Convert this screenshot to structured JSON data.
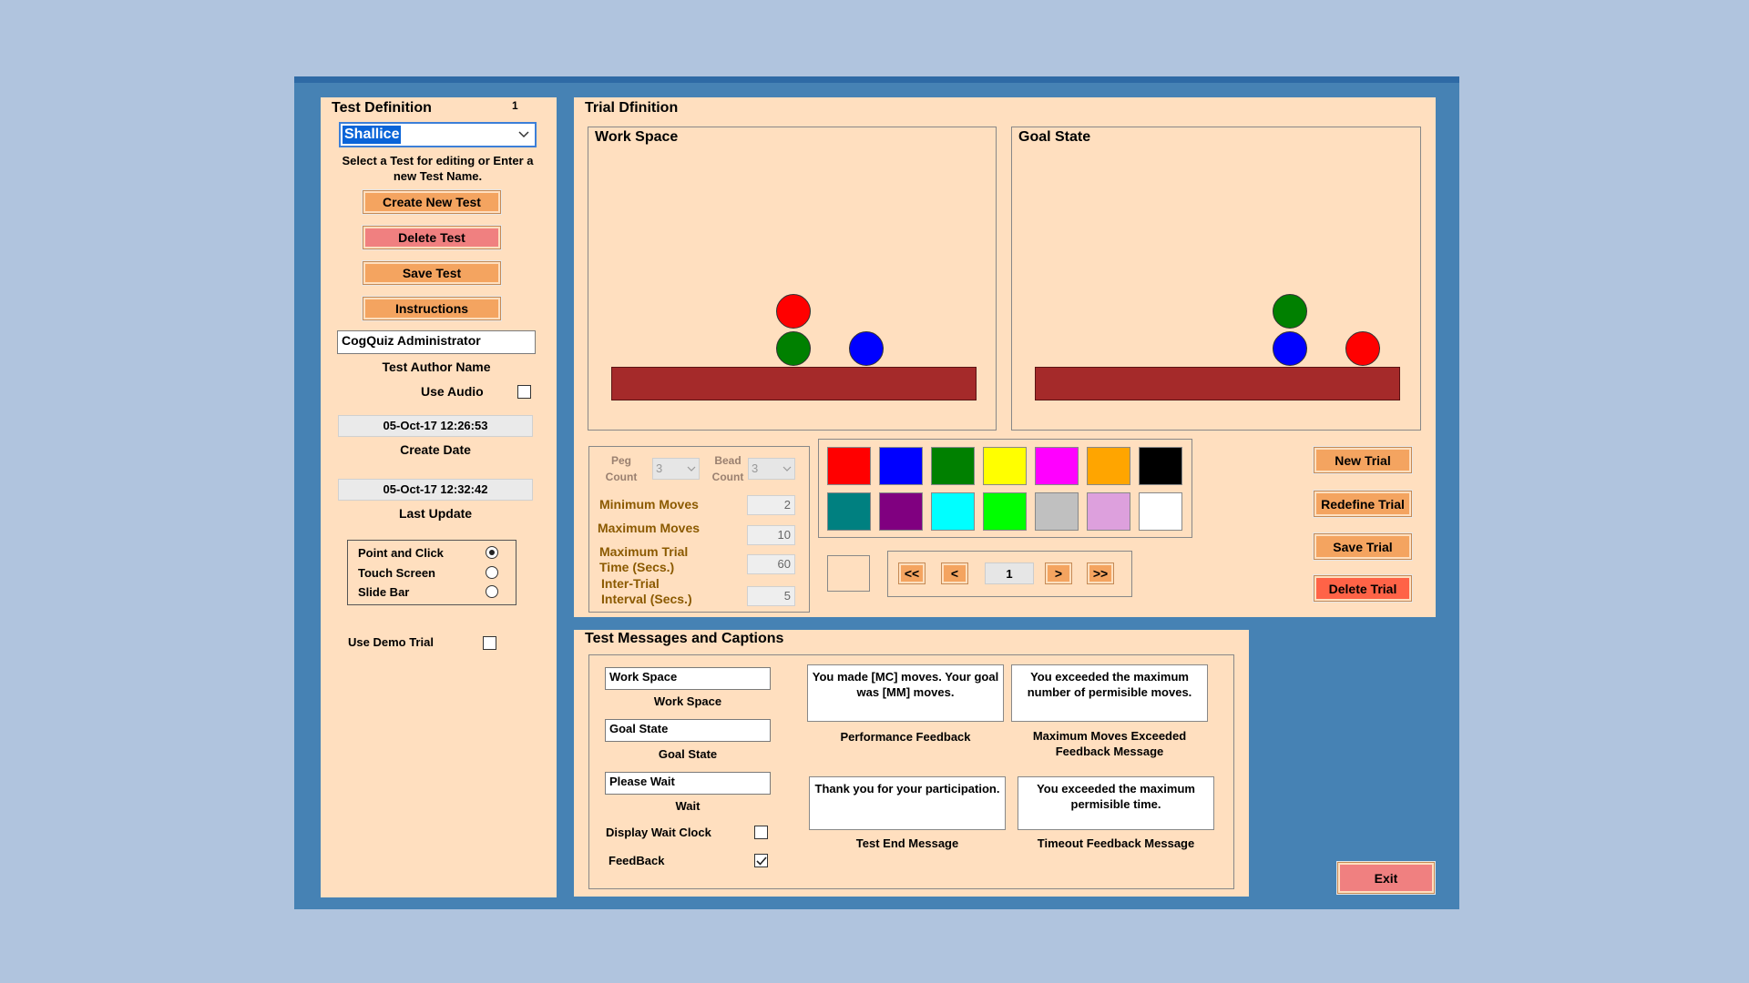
{
  "test_def": {
    "title": "Test Definition",
    "number": "1",
    "selected_test": "Shallice",
    "hint": "Select a Test for editing or Enter a new Test Name.",
    "buttons": {
      "create": "Create New Test",
      "delete": "Delete Test",
      "save": "Save Test",
      "instructions": "Instructions"
    },
    "author": "CogQuiz Administrator",
    "author_label": "Test Author Name",
    "use_audio_label": "Use Audio",
    "create_date": "05-Oct-17 12:26:53",
    "create_date_label": "Create Date",
    "last_update": "05-Oct-17 12:32:42",
    "last_update_label": "Last Update",
    "input_modes": [
      "Point and Click",
      "Touch Screen",
      "Slide Bar"
    ],
    "input_mode_selected": "Point and Click",
    "use_demo_label": "Use Demo Trial"
  },
  "trial_def": {
    "title": "Trial Dfinition",
    "workspace_title": "Work Space",
    "goal_title": "Goal State",
    "peg_count_label": "Peg Count",
    "peg_count": "3",
    "bead_count_label": "Bead Count",
    "bead_count": "3",
    "min_moves_label": "Minimum Moves",
    "min_moves": "2",
    "max_moves_label": "Maximum Moves",
    "max_moves": "10",
    "max_time_label": "Maximum Trial Time (Secs.)",
    "max_time": "60",
    "inter_trial_label": "Inter-Trial Interval (Secs.)",
    "inter_trial": "5",
    "colors": [
      "#ff0000",
      "#0000ff",
      "#008000",
      "#ffff00",
      "#ff00ff",
      "#ffa500",
      "#000000",
      "#008080",
      "#800080",
      "#00ffff",
      "#00ff00",
      "#c0c0c0",
      "#dda0dd",
      "#ffffff"
    ],
    "nav": {
      "first": "<<",
      "prev": "<",
      "current": "1",
      "next": ">",
      "last": ">>"
    },
    "buttons": {
      "new": "New Trial",
      "redefine": "Redefine Trial",
      "save": "Save Trial",
      "delete": "Delete Trial"
    }
  },
  "messages": {
    "title": "Test Messages and Captions",
    "workspace_value": "Work Space",
    "workspace_label": "Work Space",
    "goal_value": "Goal State",
    "goal_label": "Goal State",
    "wait_value": "Please Wait",
    "wait_label": "Wait",
    "display_wait_clock_label": "Display Wait Clock",
    "feedback_label": "FeedBack",
    "perf_msg": "You made [MC] moves. Your goal was [MM] moves.",
    "perf_label": "Performance Feedback",
    "maxmoves_msg": "You exceeded the maximum number of permisible moves.",
    "maxmoves_label": "Maximum Moves Exceeded Feedback Message",
    "end_msg": "Thank you for your participation.",
    "end_label": "Test End Message",
    "timeout_msg": "You exceeded the maximum permisible time.",
    "timeout_label": "Timeout Feedback Message"
  },
  "exit_label": "Exit"
}
